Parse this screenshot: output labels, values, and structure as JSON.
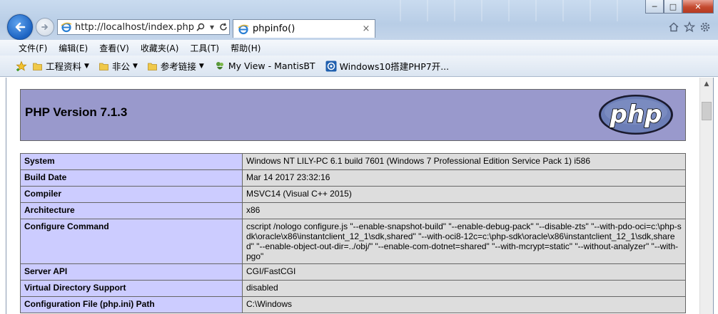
{
  "window": {
    "min_label": "─",
    "max_label": "□",
    "close_label": "✕"
  },
  "address_bar": {
    "url": "http://localhost/index.php"
  },
  "tab": {
    "title": "phpinfo()",
    "close_label": "×"
  },
  "menu": {
    "items": [
      "文件(F)",
      "编辑(E)",
      "查看(V)",
      "收藏夹(A)",
      "工具(T)",
      "帮助(H)"
    ]
  },
  "favorites": {
    "items": [
      {
        "label": "工程资料",
        "icon": "folder-icon",
        "dropdown": true
      },
      {
        "label": "非公",
        "icon": "folder-icon",
        "dropdown": true
      },
      {
        "label": "参考链接",
        "icon": "folder-icon",
        "dropdown": true
      },
      {
        "label": "My View - MantisBT",
        "icon": "mantis-icon",
        "dropdown": false
      },
      {
        "label": "Windows10搭建PHP7开...",
        "icon": "site-icon",
        "dropdown": false
      }
    ]
  },
  "page": {
    "header_title": "PHP Version 7.1.3",
    "logo_text": "php",
    "rows": [
      {
        "key": "System",
        "value": "Windows NT LILY-PC 6.1 build 7601 (Windows 7 Professional Edition Service Pack 1) i586"
      },
      {
        "key": "Build Date",
        "value": "Mar 14 2017 23:32:16"
      },
      {
        "key": "Compiler",
        "value": "MSVC14 (Visual C++ 2015)"
      },
      {
        "key": "Architecture",
        "value": "x86"
      },
      {
        "key": "Configure Command",
        "value": "cscript /nologo configure.js \"--enable-snapshot-build\" \"--enable-debug-pack\" \"--disable-zts\" \"--with-pdo-oci=c:\\php-sdk\\oracle\\x86\\instantclient_12_1\\sdk,shared\" \"--with-oci8-12c=c:\\php-sdk\\oracle\\x86\\instantclient_12_1\\sdk,shared\" \"--enable-object-out-dir=../obj/\" \"--enable-com-dotnet=shared\" \"--with-mcrypt=static\" \"--without-analyzer\" \"--with-pgo\""
      },
      {
        "key": "Server API",
        "value": "CGI/FastCGI"
      },
      {
        "key": "Virtual Directory Support",
        "value": "disabled"
      },
      {
        "key": "Configuration File (php.ini) Path",
        "value": "C:\\Windows"
      }
    ]
  },
  "colors": {
    "php_header_bg": "#9999cc",
    "key_cell_bg": "#ccccff",
    "value_cell_bg": "#dddddd",
    "logo_bg": "#6c7eb7"
  }
}
